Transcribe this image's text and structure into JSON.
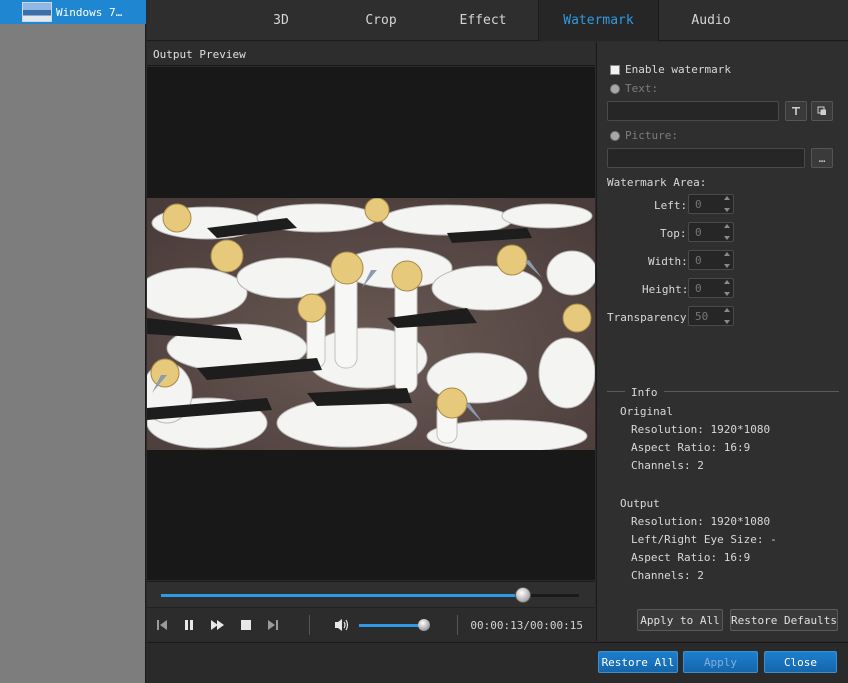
{
  "file_list": {
    "items": [
      {
        "name": "Windows 7…"
      }
    ]
  },
  "tabs": [
    {
      "label": "3D"
    },
    {
      "label": "Crop"
    },
    {
      "label": "Effect"
    },
    {
      "label": "Watermark",
      "active": true
    },
    {
      "label": "Audio"
    }
  ],
  "preview": {
    "label": "Output Preview",
    "progress_fraction": 0.865,
    "volume_fraction": 0.98,
    "time": "00:00:13/00:00:15"
  },
  "watermark": {
    "enable_label": "Enable watermark",
    "enabled": false,
    "text_option_label": "Text:",
    "text_value": "",
    "picture_option_label": "Picture:",
    "picture_value": "",
    "browse_label": "…",
    "area_label": "Watermark Area:",
    "left_label": "Left:",
    "left_value": "0",
    "top_label": "Top:",
    "top_value": "0",
    "width_label": "Width:",
    "width_value": "0",
    "height_label": "Height:",
    "height_value": "0",
    "transparency_label": "Transparency:",
    "transparency_value": "50"
  },
  "info": {
    "title": "Info",
    "original": {
      "heading": "Original",
      "resolution": "Resolution: 1920*1080",
      "aspect": "Aspect Ratio: 16:9",
      "channels": "Channels: 2"
    },
    "output": {
      "heading": "Output",
      "resolution": "Resolution: 1920*1080",
      "eye_size": "Left/Right Eye Size: -",
      "aspect": "Aspect Ratio: 16:9",
      "channels": "Channels: 2"
    }
  },
  "buttons": {
    "apply_to_all": "Apply to All",
    "restore_defaults": "Restore Defaults",
    "restore_all": "Restore All",
    "apply": "Apply",
    "close": "Close"
  },
  "colors": {
    "accent": "#2e9ae4",
    "selected_row": "#1f87d2",
    "panel": "#2f2f2f"
  }
}
